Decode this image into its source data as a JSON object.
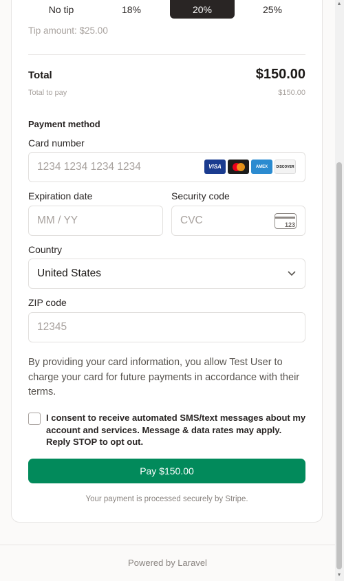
{
  "tips": {
    "options": [
      {
        "label": "No tip"
      },
      {
        "label": "18%"
      },
      {
        "label": "20%",
        "selected": true
      },
      {
        "label": "25%"
      }
    ],
    "amount_text": "Tip amount: $25.00"
  },
  "summary": {
    "total_label": "Total",
    "total_value": "$150.00",
    "total_to_pay_label": "Total to pay",
    "total_to_pay_value": "$150.00"
  },
  "payment": {
    "section_title": "Payment method",
    "card_number_label": "Card number",
    "card_number_placeholder": "1234 1234 1234 1234",
    "card_brands": [
      "VISA",
      "AMEX",
      "DISCOVER"
    ],
    "expiration_label": "Expiration date",
    "expiration_placeholder": "MM / YY",
    "security_label": "Security code",
    "security_placeholder": "CVC",
    "cvc_icon_text": "123",
    "country_label": "Country",
    "country_value": "United States",
    "zip_label": "ZIP code",
    "zip_placeholder": "12345"
  },
  "disclaimer": "By providing your card information, you allow Test User to charge your card for future payments in accordance with their terms.",
  "consent": {
    "checked": false,
    "text": "I consent to receive automated SMS/text messages about my account and services. Message & data rates may apply. Reply STOP to opt out."
  },
  "pay_button_label": "Pay $150.00",
  "secure_note": "Your payment is processed securely by Stripe.",
  "footer": "Powered by Laravel",
  "colors": {
    "accent": "#028a5b",
    "selected_tip": "#292524"
  }
}
